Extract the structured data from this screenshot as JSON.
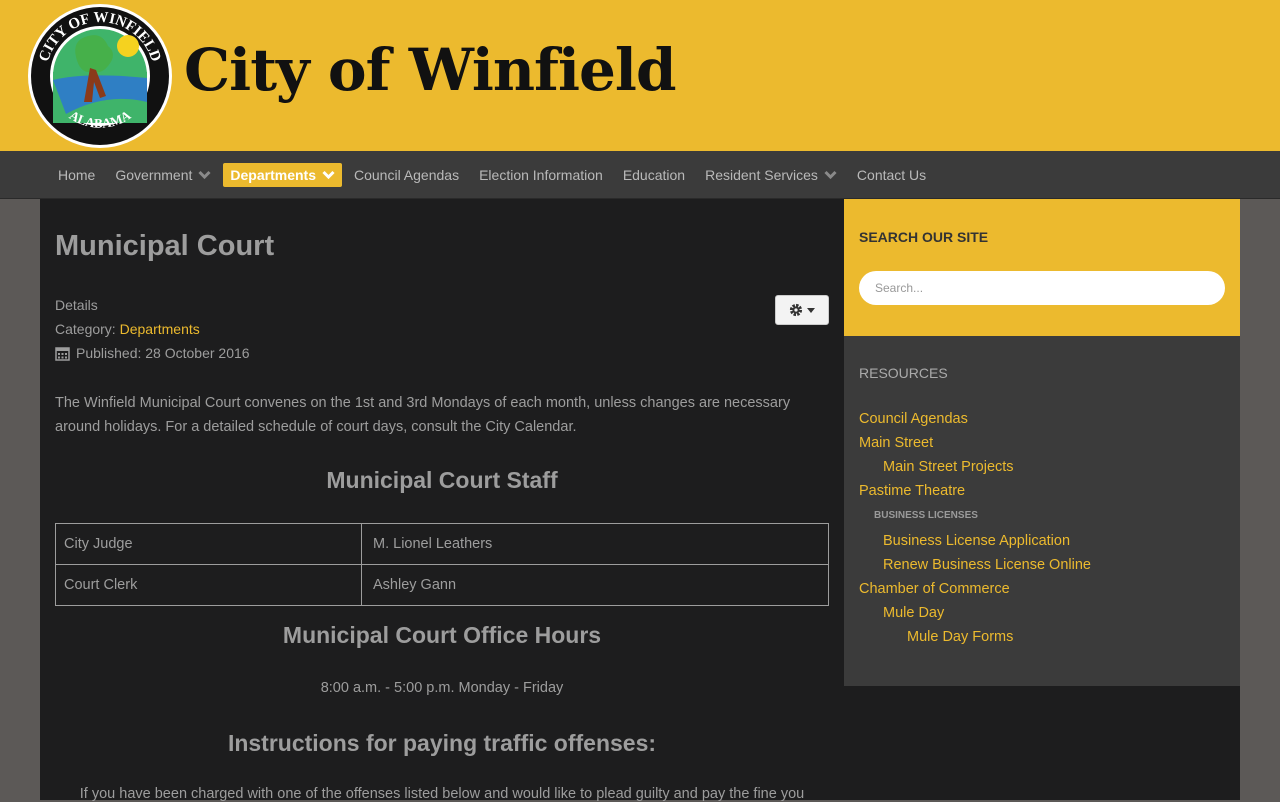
{
  "header": {
    "seal_text_top": "CITY OF WINFIELD",
    "seal_text_bottom": "ALABAMA",
    "site_title": "City of Winfield"
  },
  "nav": {
    "items": [
      {
        "label": "Home",
        "dropdown": false,
        "active": false
      },
      {
        "label": "Government",
        "dropdown": true,
        "active": false
      },
      {
        "label": "Departments",
        "dropdown": true,
        "active": true
      },
      {
        "label": "Council Agendas",
        "dropdown": false,
        "active": false
      },
      {
        "label": "Election Information",
        "dropdown": false,
        "active": false
      },
      {
        "label": "Education",
        "dropdown": false,
        "active": false
      },
      {
        "label": "Resident Services",
        "dropdown": true,
        "active": false
      },
      {
        "label": "Contact Us",
        "dropdown": false,
        "active": false
      }
    ]
  },
  "article": {
    "title": "Municipal Court",
    "details_label": "Details",
    "category_label": "Category:",
    "category_value": "Departments",
    "published": "Published: 28 October 2016",
    "intro": "The Winfield Municipal Court convenes on the 1st and 3rd Mondays of each month, unless changes are necessary around holidays. For a detailed schedule of court days, consult the City Calendar.",
    "staff_heading": "Municipal Court Staff",
    "staff": [
      {
        "role": "City Judge",
        "name": "M. Lionel Leathers"
      },
      {
        "role": "Court Clerk",
        "name": "Ashley Gann"
      }
    ],
    "hours_heading": "Municipal Court Office Hours",
    "hours": "8:00 a.m. - 5:00 p.m. Monday - Friday",
    "instructions_heading": "Instructions for paying traffic offenses:",
    "instructions_text": "If you have been charged with one of the offenses listed below and would like to plead guilty and pay the fine you"
  },
  "sidebar": {
    "search_title": "SEARCH OUR SITE",
    "search_placeholder": "Search...",
    "resources_title": "RESOURCES",
    "links": [
      {
        "label": "Council Agendas",
        "level": 0
      },
      {
        "label": "Main Street",
        "level": 0
      },
      {
        "label": "Main Street Projects",
        "level": 1
      },
      {
        "label": "Pastime Theatre",
        "level": 0
      },
      {
        "label": "BUSINESS LICENSES",
        "level": "label"
      },
      {
        "label": "Business License Application",
        "level": 1
      },
      {
        "label": "Renew Business License Online",
        "level": 1
      },
      {
        "label": "Chamber of Commerce",
        "level": 0
      },
      {
        "label": "Mule Day",
        "level": 1
      },
      {
        "label": "Mule Day Forms",
        "level": 2
      }
    ]
  },
  "colors": {
    "brand_yellow": "#ecba2e",
    "nav_bg": "#3b3b3b",
    "content_bg": "#1d1d1e",
    "text_gray": "#9d9d9d"
  }
}
